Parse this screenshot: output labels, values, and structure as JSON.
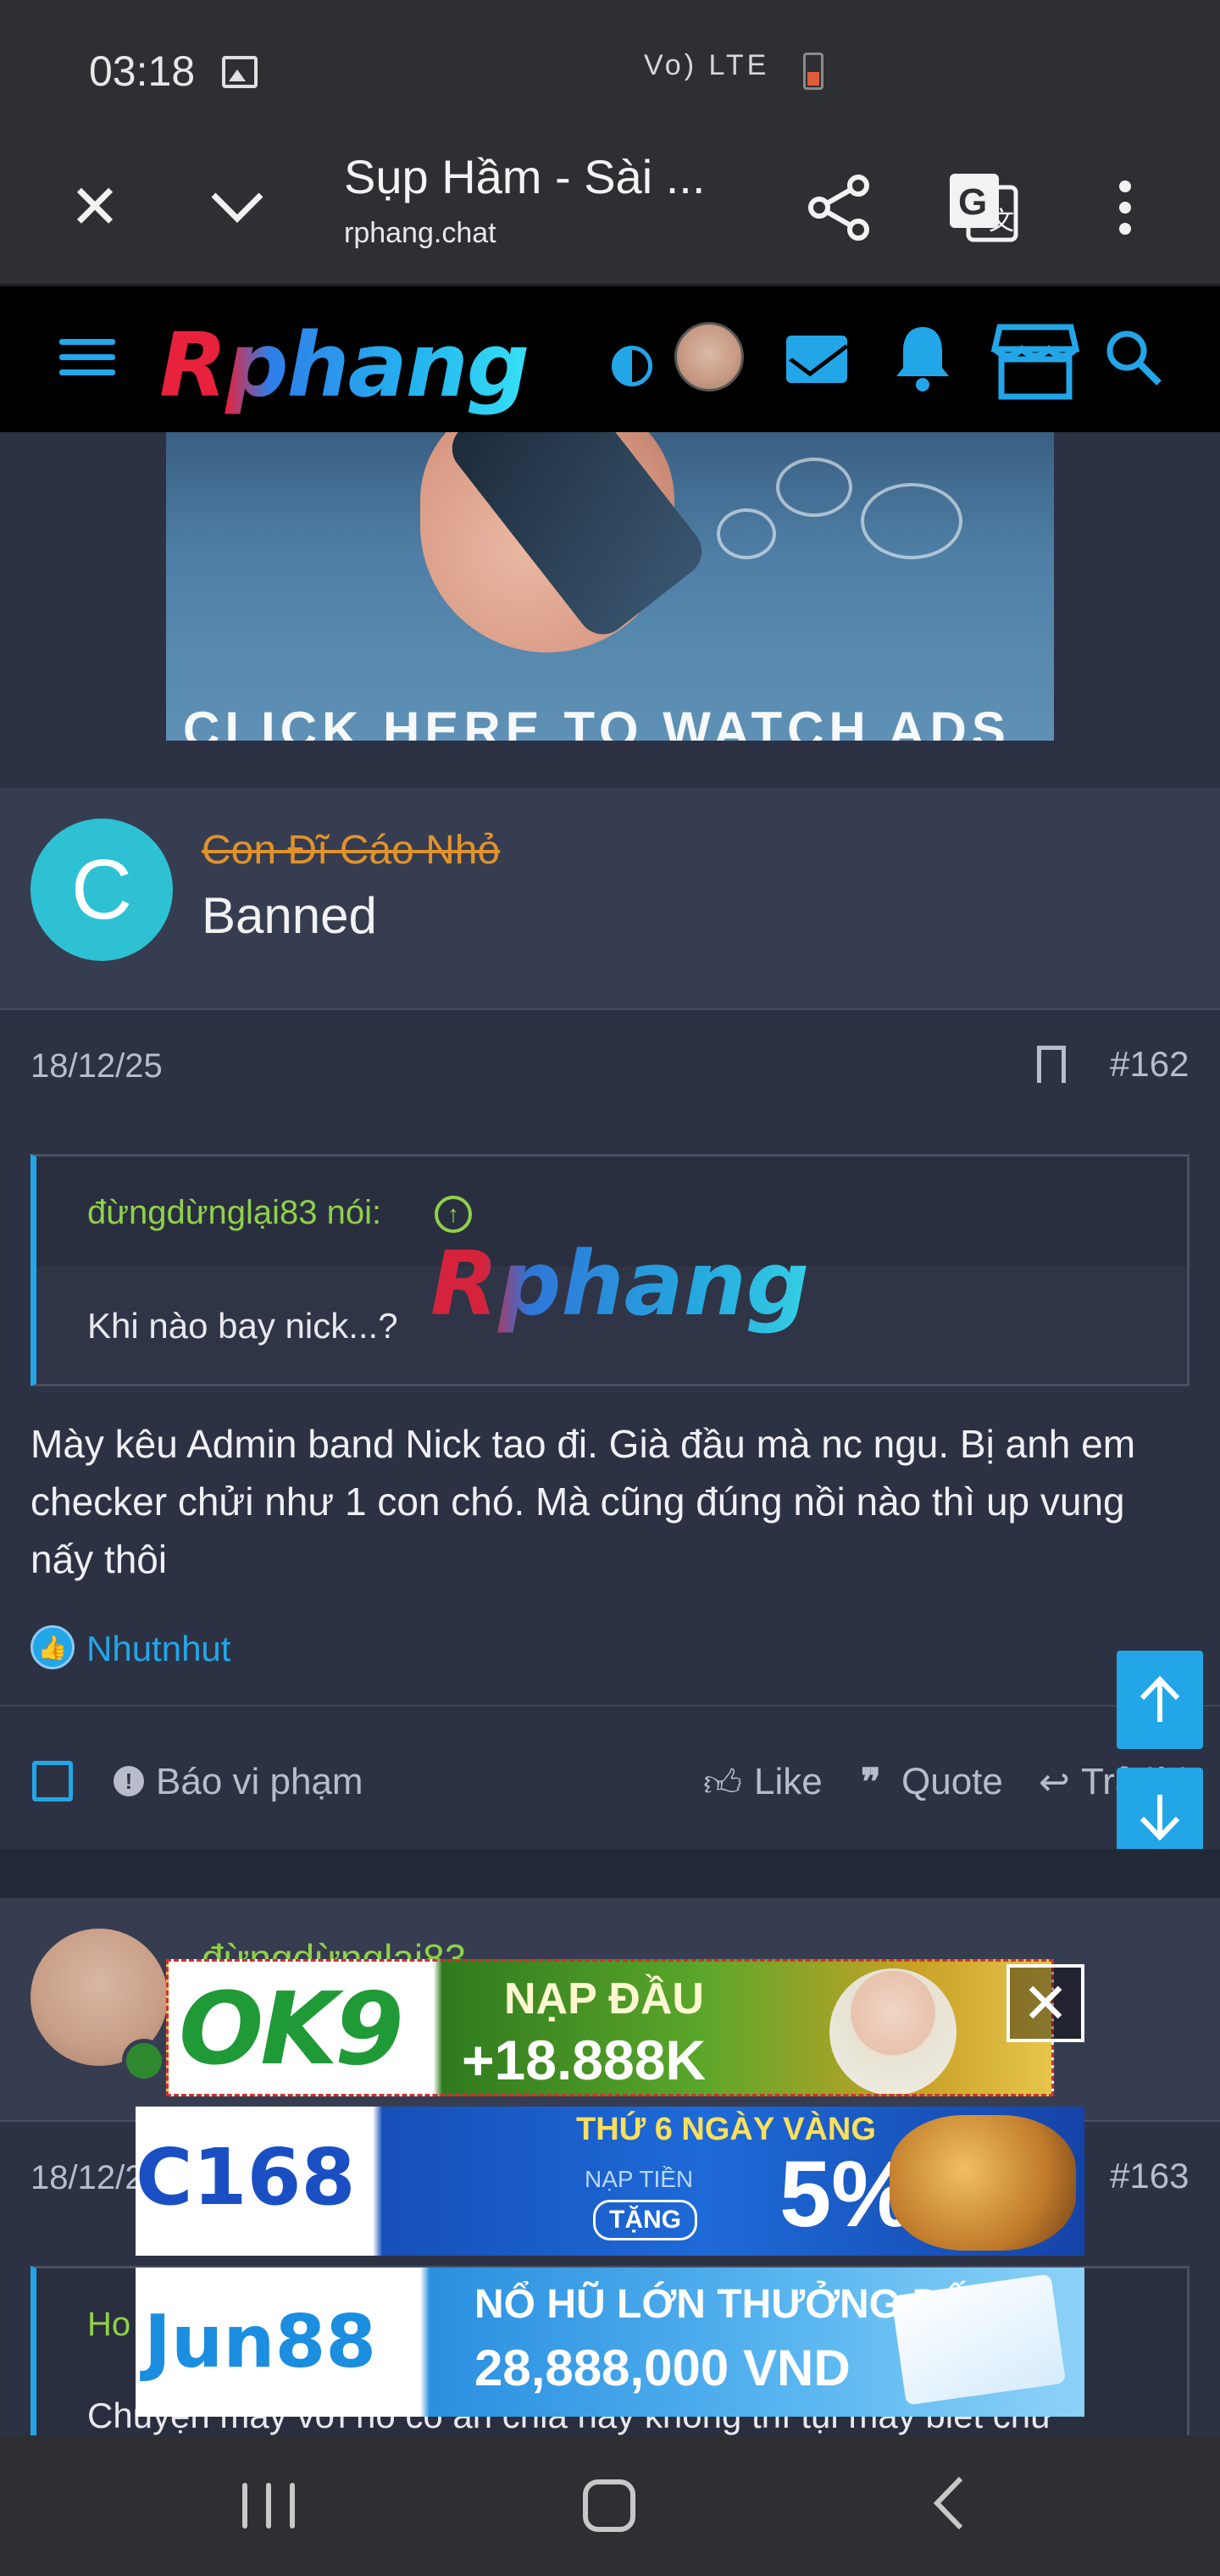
{
  "status_bar": {
    "time": "03:18",
    "network": "Vo) LTE"
  },
  "browser": {
    "title": "Sụp Hầm - Sài ...",
    "url": "rphang.chat"
  },
  "site": {
    "logo": "Rphang",
    "accent_color": "#23a6e8"
  },
  "ad_top": {
    "caption": "CLICK HERE TO WATCH ADS"
  },
  "post1": {
    "avatar_letter": "C",
    "username": "Con Đĩ Cáo Nhỏ",
    "user_title": "Banned",
    "date": "18/12/25",
    "number": "#162",
    "quote_author": "đừngdừnglại83 nói:",
    "quote_text": "Khi nào bay nick...?",
    "watermark": "Rphang",
    "text": "Mày kêu Admin band Nick tao đi. Già đầu mà nc ngu. Bị anh em checker chửi như 1 con chó. Mà cũng đúng nồi nào thì up vung nấy thôi",
    "reaction_user": "Nhutnhut",
    "actions": {
      "report": "Báo vi phạm",
      "like": "Like",
      "quote": "Quote",
      "reply": "Trả lời"
    }
  },
  "post2": {
    "username": "đừngdừnglại83",
    "date": "18/12/25",
    "number": "#163",
    "quote_author": "Ho",
    "quote_text": "Chuyện mày với nó có ăn chia hay không thì tụi mày biết chứ"
  },
  "ads": {
    "ok9": {
      "logo": "OK9",
      "line1": "NẠP ĐẦU",
      "line2": "+18.888K"
    },
    "c168": {
      "logo": "C168",
      "tag": "THỨ 6 NGÀY VÀNG",
      "sub": "NẠP TIỀN",
      "tang": "TẶNG",
      "percent": "5%"
    },
    "jun88": {
      "logo": "Jun88",
      "line1": "NỔ HŨ LỚN THƯỞNG ĐẾN",
      "line2": "28,888,000 VND"
    }
  }
}
